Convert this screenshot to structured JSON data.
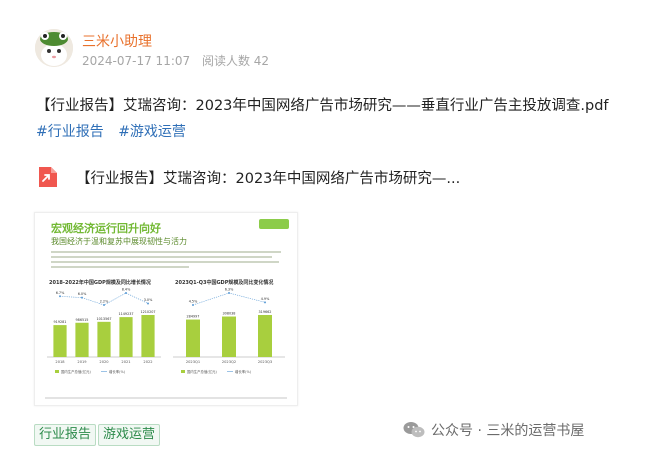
{
  "author": {
    "name": "三米小助理"
  },
  "meta": {
    "date": "2024-07-17 11:07",
    "readers": "阅读人数 42"
  },
  "post": {
    "title": "【行业报告】艾瑞咨询：2023年中国网络广告市场研究——垂直行业广告主投放调查.pdf",
    "tags": [
      "#行业报告",
      "#游戏运营"
    ]
  },
  "attachment": {
    "title": "【行业报告】艾瑞咨询：2023年中国网络广告市场研究—...",
    "icon": "share-pdf-icon"
  },
  "thumbnail": {
    "heading": "宏观经济运行回升向好",
    "subheading": "我国经济于温和复苏中展现韧性与活力"
  },
  "chart_data": [
    {
      "type": "bar",
      "title": "2018-2022年中国GDP规模及同比增长情况",
      "categories": [
        "2018",
        "2019",
        "2020",
        "2021",
        "2022"
      ],
      "values": [
        919281,
        986515,
        1013567,
        1149237,
        1210207
      ],
      "labels": [
        "919281",
        "986515",
        "1013567",
        "1149237",
        "1210207"
      ],
      "line_labels": [
        "6.7%",
        "6.0%",
        "2.2%",
        "8.4%",
        "3.0%"
      ],
      "line_values": [
        6.7,
        6.0,
        2.2,
        8.4,
        3.0
      ],
      "legend": [
        "国内生产总值(亿元)",
        "增长率(%)"
      ],
      "colors": {
        "bar": "#a8cf3e",
        "line": "#5b9bd5"
      }
    },
    {
      "type": "bar",
      "title": "2023Q1-Q3中国GDP规模及同比变化情况",
      "categories": [
        "2023Q1",
        "2023Q2",
        "2023Q3"
      ],
      "values": [
        284997,
        308038,
        319662
      ],
      "labels": [
        "284997",
        "308038",
        "319662"
      ],
      "line_labels": [
        "4.5%",
        "6.3%",
        "4.9%"
      ],
      "line_values": [
        4.5,
        6.3,
        4.9
      ],
      "legend": [
        "国内生产总值(亿元)",
        "增长率(%)"
      ],
      "colors": {
        "bar": "#a8cf3e",
        "line": "#5b9bd5"
      }
    }
  ],
  "bottom_tags": [
    "行业报告",
    "游戏运营"
  ],
  "footer": {
    "text": "公众号 · 三米的运营书屋"
  }
}
